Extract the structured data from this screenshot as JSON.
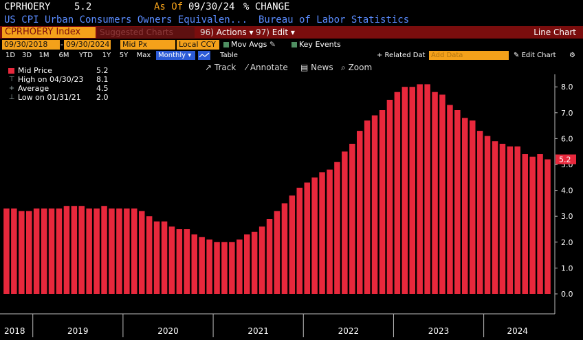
{
  "header": {
    "ticker": "CPRHOERY",
    "last": "5.2",
    "as_of_label": "As Of",
    "as_of_date": "09/30/24",
    "change_label": "% CHANGE",
    "name": "US CPI Urban Consumers Owners Equivalen...",
    "source": "Bureau of Labor Statistics"
  },
  "toolbar": {
    "security": "CPRHOERY Index",
    "suggested": "Suggested Charts",
    "actions_num": "96)",
    "actions_label": "Actions",
    "edit_num": "97)",
    "edit_label": "Edit",
    "chart_kind": "Line Chart"
  },
  "controls": {
    "start_date": "09/30/2018",
    "end_date": "09/30/2024",
    "price_field": "Mid Px",
    "currency": "Local CCY",
    "mov_avgs": "Mov Avgs",
    "key_events": "Key Events"
  },
  "ranges": [
    "1D",
    "3D",
    "1M",
    "6M",
    "YTD",
    "1Y",
    "5Y",
    "Max"
  ],
  "frequency": "Monthly",
  "table_label": "Table",
  "related_data": "+ Related Dat",
  "add_data_placeholder": "Add Data",
  "edit_chart": "Edit Chart",
  "tools": {
    "track": "Track",
    "annotate": "Annotate",
    "news": "News",
    "zoom": "Zoom"
  },
  "legend": [
    {
      "label": "Mid Price",
      "value": "5.2",
      "color": "#e8283c"
    },
    {
      "label": "High on 04/30/23",
      "value": "8.1"
    },
    {
      "label": "Average",
      "value": "4.5"
    },
    {
      "label": "Low on 01/31/21",
      "value": "2.0"
    }
  ],
  "colors": {
    "bar": "#e8283c",
    "accent_orange": "#f4a11a",
    "toolbar_red": "#7a0d0d",
    "title_blue": "#5a8cff"
  },
  "chart_data": {
    "type": "bar",
    "title": "",
    "xlabel": "",
    "ylabel": "",
    "ylim": [
      0,
      8.6
    ],
    "yticks": [
      "0.0",
      "1.0",
      "2.0",
      "3.0",
      "4.0",
      "5.0",
      "6.0",
      "7.0",
      "8.0"
    ],
    "x_year_labels": [
      "2018",
      "2019",
      "2020",
      "2021",
      "2022",
      "2023",
      "2024"
    ],
    "last_value_label": "5.2",
    "x": [
      "2018-09",
      "2018-10",
      "2018-11",
      "2018-12",
      "2019-01",
      "2019-02",
      "2019-03",
      "2019-04",
      "2019-05",
      "2019-06",
      "2019-07",
      "2019-08",
      "2019-09",
      "2019-10",
      "2019-11",
      "2019-12",
      "2020-01",
      "2020-02",
      "2020-03",
      "2020-04",
      "2020-05",
      "2020-06",
      "2020-07",
      "2020-08",
      "2020-09",
      "2020-10",
      "2020-11",
      "2020-12",
      "2021-01",
      "2021-02",
      "2021-03",
      "2021-04",
      "2021-05",
      "2021-06",
      "2021-07",
      "2021-08",
      "2021-09",
      "2021-10",
      "2021-11",
      "2021-12",
      "2022-01",
      "2022-02",
      "2022-03",
      "2022-04",
      "2022-05",
      "2022-06",
      "2022-07",
      "2022-08",
      "2022-09",
      "2022-10",
      "2022-11",
      "2022-12",
      "2023-01",
      "2023-02",
      "2023-03",
      "2023-04",
      "2023-05",
      "2023-06",
      "2023-07",
      "2023-08",
      "2023-09",
      "2023-10",
      "2023-11",
      "2023-12",
      "2024-01",
      "2024-02",
      "2024-03",
      "2024-04",
      "2024-05",
      "2024-06",
      "2024-07",
      "2024-08",
      "2024-09"
    ],
    "values": [
      3.3,
      3.3,
      3.2,
      3.2,
      3.3,
      3.3,
      3.3,
      3.3,
      3.4,
      3.4,
      3.4,
      3.3,
      3.3,
      3.4,
      3.3,
      3.3,
      3.3,
      3.3,
      3.2,
      3.0,
      2.8,
      2.8,
      2.6,
      2.5,
      2.5,
      2.3,
      2.2,
      2.1,
      2.0,
      2.0,
      2.0,
      2.1,
      2.3,
      2.4,
      2.6,
      2.9,
      3.2,
      3.5,
      3.8,
      4.1,
      4.3,
      4.5,
      4.7,
      4.8,
      5.1,
      5.5,
      5.8,
      6.3,
      6.7,
      6.9,
      7.1,
      7.5,
      7.8,
      8.0,
      8.0,
      8.1,
      8.1,
      7.8,
      7.7,
      7.3,
      7.1,
      6.8,
      6.7,
      6.3,
      6.1,
      5.9,
      5.8,
      5.7,
      5.7,
      5.4,
      5.3,
      5.4,
      5.2
    ],
    "grid": false,
    "legend_position": "top-left"
  }
}
